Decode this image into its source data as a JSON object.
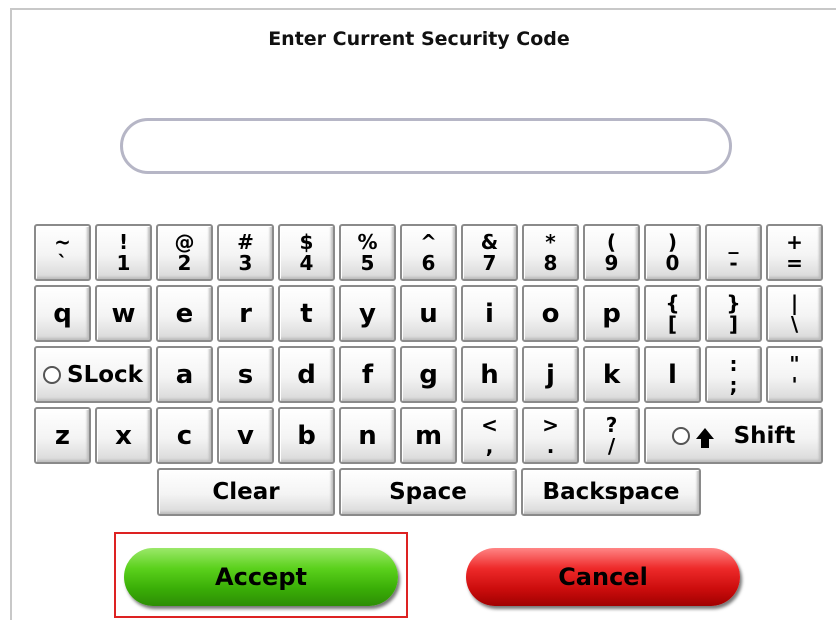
{
  "title": "Enter Current Security Code",
  "code_value": "",
  "keyboard": {
    "row1": [
      {
        "top": "~",
        "bot": "`"
      },
      {
        "top": "!",
        "bot": "1"
      },
      {
        "top": "@",
        "bot": "2"
      },
      {
        "top": "#",
        "bot": "3"
      },
      {
        "top": "$",
        "bot": "4"
      },
      {
        "top": "%",
        "bot": "5"
      },
      {
        "top": "^",
        "bot": "6"
      },
      {
        "top": "&",
        "bot": "7"
      },
      {
        "top": "*",
        "bot": "8"
      },
      {
        "top": "(",
        "bot": "9"
      },
      {
        "top": ")",
        "bot": "0"
      },
      {
        "top": "_",
        "bot": "-"
      },
      {
        "top": "+",
        "bot": "="
      }
    ],
    "row2": [
      "q",
      "w",
      "e",
      "r",
      "t",
      "y",
      "u",
      "i",
      "o",
      "p"
    ],
    "row2_pairs": [
      {
        "top": "{",
        "bot": "["
      },
      {
        "top": "}",
        "bot": "]"
      },
      {
        "top": "|",
        "bot": "\\"
      }
    ],
    "slock": "SLock",
    "row3": [
      "a",
      "s",
      "d",
      "f",
      "g",
      "h",
      "j",
      "k",
      "l"
    ],
    "row3_pairs": [
      {
        "top": ":",
        "bot": ";"
      },
      {
        "top": "\"",
        "bot": "'"
      }
    ],
    "row4": [
      "z",
      "x",
      "c",
      "v",
      "b",
      "n",
      "m"
    ],
    "row4_pairs": [
      {
        "top": "<",
        "bot": ","
      },
      {
        "top": ">",
        "bot": "."
      },
      {
        "top": "?",
        "bot": "/"
      }
    ],
    "shift": "Shift",
    "clear": "Clear",
    "space": "Space",
    "backspace": "Backspace"
  },
  "buttons": {
    "accept": "Accept",
    "cancel": "Cancel"
  },
  "colors": {
    "accept": "#4cc313",
    "cancel": "#e01c1c",
    "highlight": "#dd2222"
  }
}
